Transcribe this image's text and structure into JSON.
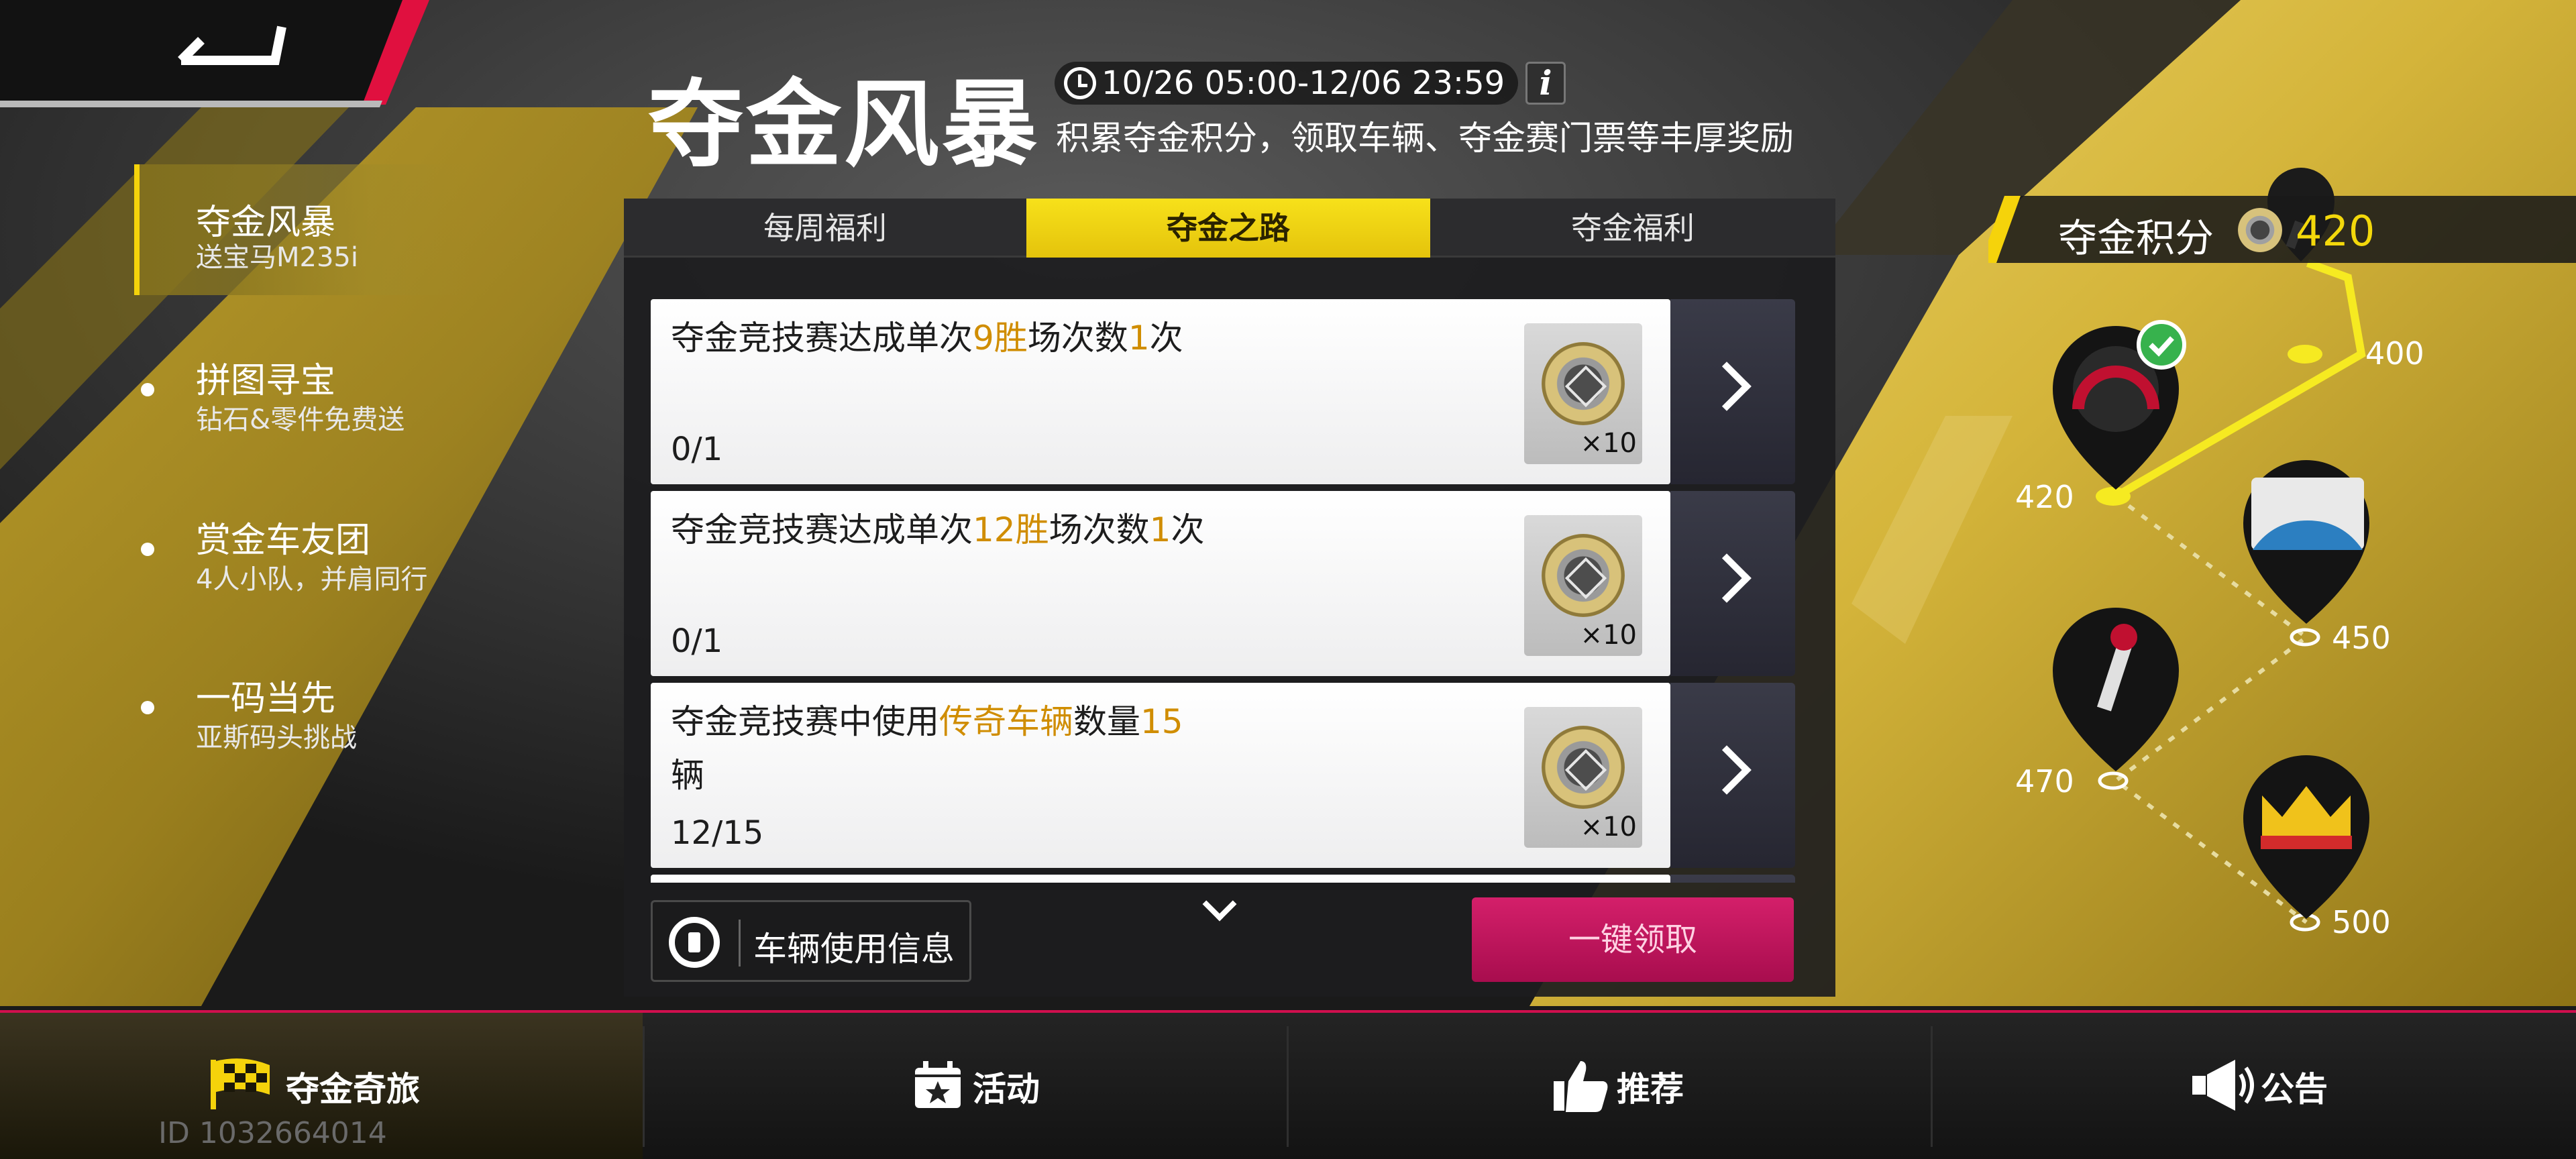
{
  "header": {
    "title": "夺金风暴",
    "timer": "10/26 05:00-12/06 23:59",
    "info_label": "i",
    "subtitle": "积累夺金积分，领取车辆、夺金赛门票等丰厚奖励"
  },
  "nav": {
    "items": [
      {
        "label": "夺金风暴",
        "sub": "送宝马M235i",
        "active": true
      },
      {
        "label": "拼图寻宝",
        "sub": "钻石&零件免费送",
        "active": false
      },
      {
        "label": "赏金车友团",
        "sub": "4人小队，并肩同行",
        "active": false
      },
      {
        "label": "一码当先",
        "sub": "亚斯码头挑战",
        "active": false
      }
    ]
  },
  "tabs": [
    "每周福利",
    "夺金之路",
    "夺金福利"
  ],
  "tasks": [
    {
      "desc": [
        "夺金竞技赛达成单次",
        "9胜",
        "场次数",
        "1",
        "次"
      ],
      "progress": "0/1",
      "reward_qty": "×10"
    },
    {
      "desc": [
        "夺金竞技赛达成单次",
        "12胜",
        "场次数",
        "1",
        "次"
      ],
      "progress": "0/1",
      "reward_qty": "×10"
    },
    {
      "desc": [
        "夺金竞技赛中使用",
        "传奇车辆",
        "数量",
        "15",
        "辆"
      ],
      "progress": "12/15",
      "reward_qty": "×10"
    }
  ],
  "buttons": {
    "vehicle_info": "车辆使用信息",
    "claim_all": "一键领取"
  },
  "points": {
    "label": "夺金积分",
    "value": "420",
    "milestones": [
      "400",
      "420",
      "450",
      "470",
      "500"
    ]
  },
  "bottom_bar": {
    "tabs": [
      "夺金奇旅",
      "活动",
      "推荐",
      "公告"
    ],
    "user_id": "ID 1032664014"
  },
  "colors": {
    "accent_yellow": "#f5d30b",
    "highlight_orange": "#d08d00",
    "claim_pink": "#c0145b",
    "bottom_red": "#d00f4e"
  }
}
